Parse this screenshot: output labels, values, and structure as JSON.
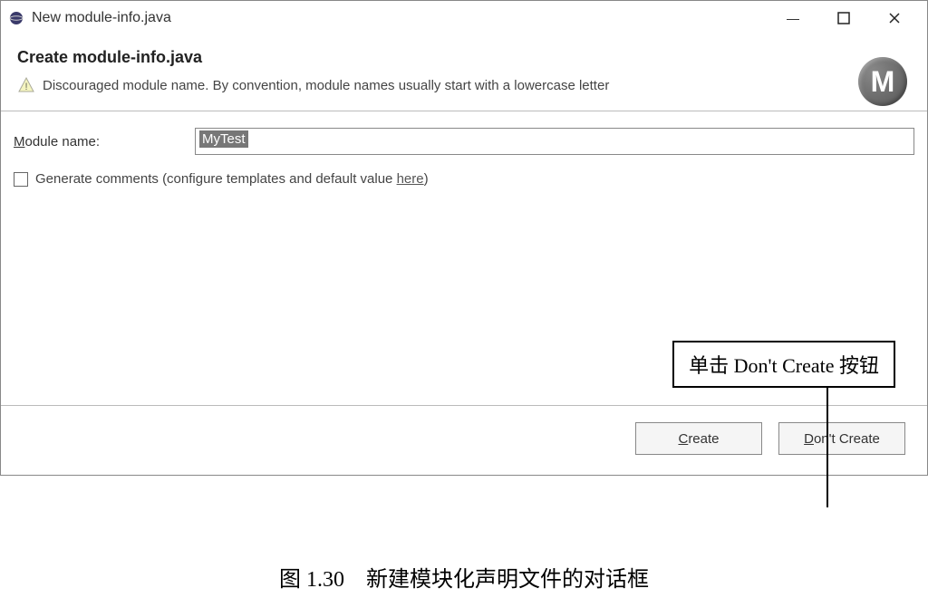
{
  "titlebar": {
    "title": "New module-info.java"
  },
  "header": {
    "title": "Create module-info.java",
    "warning": "Discouraged module name. By convention, module names usually start with a lowercase letter",
    "badge": "M"
  },
  "form": {
    "module_label": "Module name:",
    "module_value": "MyTest",
    "checkbox_label_prefix": "Generate comments (configure templates and default value ",
    "checkbox_link": "here",
    "checkbox_label_suffix": ")"
  },
  "buttons": {
    "create": "Create",
    "dont_create": "Don't Create"
  },
  "callout": {
    "text": "单击 Don't Create 按钮"
  },
  "caption": "图 1.30　新建模块化声明文件的对话框"
}
